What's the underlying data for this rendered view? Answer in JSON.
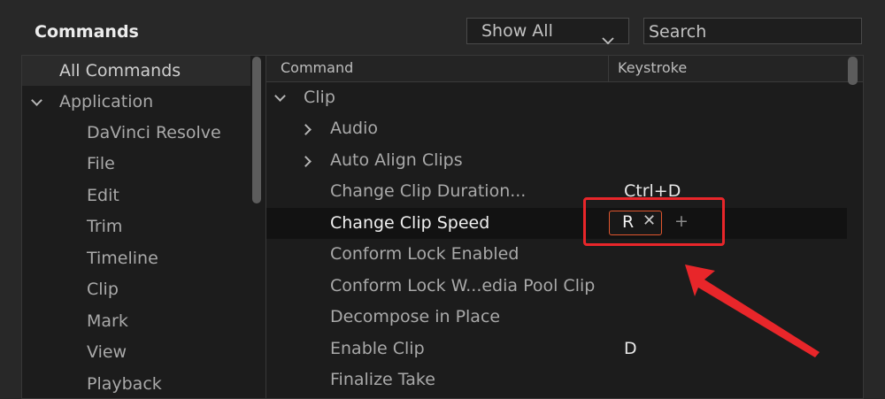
{
  "header": {
    "title": "Commands",
    "filter_value": "Show All",
    "search_placeholder": "Search"
  },
  "sidebar": {
    "items": [
      {
        "label": "All Commands",
        "selected": true
      },
      {
        "label": "Application",
        "expanded": true
      },
      {
        "label": "DaVinci Resolve"
      },
      {
        "label": "File"
      },
      {
        "label": "Edit"
      },
      {
        "label": "Trim"
      },
      {
        "label": "Timeline"
      },
      {
        "label": "Clip"
      },
      {
        "label": "Mark"
      },
      {
        "label": "View"
      },
      {
        "label": "Playback"
      }
    ]
  },
  "table": {
    "col_command": "Command",
    "col_keystroke": "Keystroke",
    "rows": [
      {
        "label": "Clip",
        "key": "",
        "expanded": true
      },
      {
        "label": "Audio",
        "key": "",
        "expanded": false
      },
      {
        "label": "Auto Align Clips",
        "key": "",
        "expanded": false
      },
      {
        "label": "Change Clip Duration...",
        "key": "Ctrl+D"
      },
      {
        "label": "Change Clip Speed",
        "key": "",
        "selected": true
      },
      {
        "label": "Conform Lock Enabled",
        "key": ""
      },
      {
        "label": "Conform Lock W...edia Pool Clip",
        "key": ""
      },
      {
        "label": "Decompose in Place",
        "key": ""
      },
      {
        "label": "Enable Clip",
        "key": "D"
      },
      {
        "label": "Finalize Take",
        "key": ""
      }
    ]
  },
  "editor": {
    "key": "R",
    "remove_glyph": "✕",
    "add_glyph": "+"
  },
  "colors": {
    "accent": "#e0562e",
    "annotation": "#e8262a",
    "background": "#282828",
    "panel": "#1c1c1c"
  }
}
